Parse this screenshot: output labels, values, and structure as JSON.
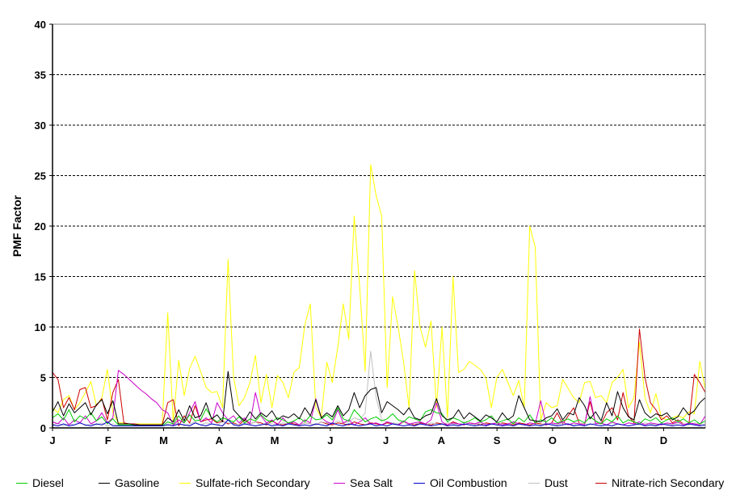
{
  "chart_data": {
    "type": "line",
    "xlabel": "",
    "ylabel": "PMF Factor",
    "ylim": [
      0,
      40
    ],
    "yticks": [
      0,
      5,
      10,
      15,
      20,
      25,
      30,
      35,
      40
    ],
    "month_labels": [
      "J",
      "F",
      "M",
      "A",
      "M",
      "J",
      "J",
      "A",
      "S",
      "O",
      "N",
      "D"
    ],
    "grid": "horizontal dashed",
    "legend_position": "bottom",
    "x_unit": "sample index (time order, Jan-Dec)",
    "x": [
      0,
      1,
      2,
      3,
      4,
      5,
      6,
      7,
      8,
      9,
      10,
      11,
      12,
      13,
      14,
      15,
      16,
      17,
      18,
      19,
      20,
      21,
      22,
      23,
      24,
      25,
      26,
      27,
      28,
      29,
      30,
      31,
      32,
      33,
      34,
      35,
      36,
      37,
      38,
      39,
      40,
      41,
      42,
      43,
      44,
      45,
      46,
      47,
      48,
      49,
      50,
      51,
      52,
      53,
      54,
      55,
      56,
      57,
      58,
      59,
      60,
      61,
      62,
      63,
      64,
      65,
      66,
      67,
      68,
      69,
      70,
      71,
      72,
      73,
      74,
      75,
      76,
      77,
      78,
      79,
      80,
      81,
      82,
      83,
      84,
      85,
      86,
      87,
      88,
      89,
      90,
      91,
      92,
      93,
      94,
      95,
      96,
      97,
      98,
      99,
      100,
      101,
      102,
      103,
      104,
      105,
      106,
      107,
      108,
      109,
      110,
      111,
      112,
      113,
      114,
      115,
      116,
      117,
      118,
      119
    ],
    "series": [
      {
        "name": "Diesel",
        "color": "#00cc00",
        "values": [
          1.0,
          1.4,
          0.8,
          1.8,
          0.6,
          1.2,
          0.9,
          1.5,
          0.7,
          1.1,
          0.4,
          0.9,
          0.3,
          0.3,
          0.3,
          0.3,
          0.2,
          0.2,
          0.2,
          0.2,
          0.2,
          0.6,
          0.4,
          1.2,
          0.5,
          1.3,
          0.7,
          0.8,
          1.9,
          1.0,
          0.6,
          1.0,
          0.8,
          0.6,
          1.1,
          0.5,
          0.9,
          0.7,
          1.3,
          0.8,
          0.6,
          1.0,
          0.8,
          0.5,
          0.7,
          1.0,
          0.6,
          1.2,
          0.8,
          0.9,
          1.3,
          0.8,
          2.0,
          0.9,
          0.7,
          1.8,
          1.2,
          0.6,
          0.9,
          1.1,
          0.7,
          0.9,
          1.4,
          0.8,
          0.6,
          1.1,
          0.9,
          0.7,
          1.6,
          1.8,
          1.5,
          1.4,
          0.6,
          1.0,
          0.8,
          0.5,
          0.7,
          1.0,
          0.6,
          0.8,
          1.2,
          0.5,
          0.7,
          0.9,
          0.4,
          1.0,
          0.6,
          1.3,
          0.5,
          0.8,
          0.6,
          1.0,
          0.5,
          0.7,
          0.9,
          0.6,
          0.8,
          0.5,
          1.1,
          0.7,
          0.4,
          0.9,
          0.6,
          1.2,
          0.5,
          0.8,
          0.6,
          0.4,
          0.9,
          0.7,
          1.0,
          0.5,
          0.8,
          1.0,
          0.6,
          0.9,
          0.5,
          0.8,
          0.4,
          0.7
        ]
      },
      {
        "name": "Gasoline",
        "color": "#000000",
        "values": [
          1.6,
          2.6,
          1.2,
          2.4,
          1.5,
          2.0,
          2.5,
          1.3,
          2.3,
          2.8,
          1.4,
          2.7,
          0.4,
          0.4,
          0.4,
          0.3,
          0.3,
          0.3,
          0.3,
          0.3,
          0.3,
          1.0,
          0.6,
          1.8,
          0.7,
          2.2,
          1.0,
          1.2,
          2.5,
          0.9,
          1.3,
          0.6,
          5.6,
          1.8,
          1.2,
          0.7,
          1.6,
          0.9,
          1.5,
          1.1,
          1.7,
          0.8,
          1.2,
          1.0,
          1.4,
          0.9,
          2.0,
          1.2,
          2.8,
          1.0,
          1.5,
          1.1,
          2.2,
          1.2,
          1.8,
          3.5,
          2.0,
          3.2,
          3.8,
          4.0,
          1.5,
          2.6,
          2.2,
          1.8,
          1.3,
          2.0,
          1.0,
          0.8,
          1.2,
          1.4,
          2.9,
          1.2,
          0.8,
          1.0,
          1.8,
          0.9,
          1.5,
          1.1,
          0.7,
          1.3,
          1.0,
          0.6,
          1.5,
          0.8,
          1.2,
          3.2,
          2.0,
          0.8,
          0.7,
          0.6,
          1.0,
          1.2,
          1.9,
          0.8,
          1.5,
          1.3,
          3.0,
          2.2,
          0.9,
          1.6,
          0.7,
          2.5,
          1.2,
          3.6,
          2.0,
          1.1,
          0.8,
          2.8,
          1.5,
          1.0,
          1.4,
          1.2,
          1.5,
          0.8,
          1.1,
          2.0,
          1.3,
          1.7,
          2.5,
          3.0
        ]
      },
      {
        "name": "Sulfate-rich Secondary",
        "color": "#ffff00",
        "values": [
          2.0,
          1.5,
          2.8,
          3.2,
          1.8,
          2.5,
          3.5,
          4.6,
          2.2,
          3.0,
          5.8,
          1.5,
          0.5,
          0.5,
          0.4,
          0.4,
          0.4,
          0.4,
          0.4,
          0.4,
          0.4,
          11.4,
          0.6,
          6.7,
          3.2,
          5.9,
          7.1,
          5.6,
          4.0,
          3.5,
          3.6,
          2.0,
          16.7,
          5.0,
          2.2,
          3.0,
          4.5,
          7.2,
          2.5,
          5.3,
          2.0,
          5.2,
          4.5,
          3.0,
          5.5,
          6.0,
          10.2,
          12.3,
          2.0,
          1.0,
          6.5,
          4.5,
          8.0,
          12.3,
          8.8,
          21.0,
          14.0,
          5.6,
          26.1,
          23.0,
          21.0,
          4.0,
          13.0,
          10.0,
          6.5,
          2.0,
          15.6,
          10.0,
          8.0,
          10.6,
          2.0,
          10.0,
          1.0,
          15.0,
          5.5,
          5.8,
          6.6,
          6.2,
          5.8,
          5.0,
          2.0,
          5.0,
          5.8,
          4.5,
          3.2,
          4.7,
          2.0,
          20.0,
          17.9,
          0.8,
          2.5,
          2.0,
          2.2,
          4.8,
          3.9,
          3.0,
          2.5,
          4.5,
          4.6,
          3.0,
          3.2,
          2.5,
          4.5,
          5.0,
          5.8,
          2.0,
          3.0,
          8.5,
          3.0,
          1.5,
          3.4,
          1.0,
          0.8,
          1.0,
          1.2,
          1.0,
          1.6,
          1.4,
          6.6,
          3.8
        ]
      },
      {
        "name": "Sea Salt",
        "color": "#cc00cc",
        "values": [
          0.6,
          0.4,
          1.0,
          0.3,
          0.8,
          0.5,
          1.2,
          0.4,
          0.7,
          1.5,
          0.5,
          1.0,
          5.7,
          5.3,
          4.8,
          4.3,
          3.8,
          3.4,
          2.9,
          2.5,
          1.8,
          1.5,
          0.3,
          0.8,
          0.5,
          1.5,
          2.6,
          0.6,
          1.0,
          0.5,
          2.5,
          1.5,
          0.8,
          1.2,
          0.5,
          1.0,
          0.4,
          3.5,
          1.2,
          0.5,
          0.8,
          0.3,
          1.0,
          0.4,
          0.6,
          0.3,
          0.8,
          0.5,
          2.9,
          1.0,
          0.6,
          0.4,
          1.8,
          0.5,
          0.8,
          0.3,
          0.6,
          1.0,
          0.4,
          0.5,
          0.3,
          0.6,
          0.4,
          0.3,
          0.7,
          0.4,
          0.5,
          0.6,
          0.4,
          0.8,
          2.5,
          0.6,
          0.3,
          0.5,
          0.4,
          0.3,
          0.5,
          0.4,
          0.6,
          0.3,
          0.4,
          0.5,
          0.3,
          0.4,
          0.6,
          0.4,
          0.3,
          0.5,
          0.4,
          2.7,
          0.3,
          0.5,
          0.4,
          0.6,
          0.3,
          0.5,
          0.4,
          0.3,
          3.1,
          0.4,
          0.5,
          0.3,
          0.6,
          0.4,
          0.3,
          0.5,
          0.4,
          0.6,
          0.3,
          0.5,
          0.4,
          0.3,
          0.5,
          0.4,
          0.6,
          0.3,
          0.5,
          0.4,
          0.3,
          1.2
        ]
      },
      {
        "name": "Oil Combustion",
        "color": "#0000cc",
        "values": [
          0.3,
          0.2,
          0.4,
          0.2,
          0.3,
          0.5,
          0.3,
          0.2,
          0.4,
          0.3,
          0.6,
          0.2,
          0.2,
          0.2,
          0.2,
          0.2,
          0.2,
          0.2,
          0.2,
          0.2,
          0.2,
          0.3,
          0.2,
          0.4,
          0.3,
          0.2,
          0.5,
          0.3,
          0.2,
          0.4,
          0.3,
          0.2,
          0.8,
          0.3,
          0.2,
          0.4,
          0.3,
          0.2,
          0.3,
          0.4,
          0.2,
          0.3,
          0.2,
          0.4,
          0.3,
          0.2,
          0.3,
          0.2,
          0.4,
          0.3,
          0.2,
          0.5,
          0.3,
          0.2,
          0.4,
          0.3,
          0.2,
          0.3,
          0.4,
          0.2,
          0.3,
          0.2,
          0.4,
          0.3,
          0.2,
          0.3,
          0.2,
          0.4,
          0.3,
          0.2,
          0.3,
          0.4,
          0.2,
          0.3,
          0.2,
          0.4,
          0.3,
          0.2,
          0.3,
          0.2,
          0.4,
          0.3,
          0.2,
          0.3,
          0.2,
          0.4,
          0.3,
          0.2,
          0.3,
          0.2,
          0.4,
          0.3,
          0.2,
          0.3,
          0.4,
          0.2,
          0.3,
          0.2,
          0.4,
          0.3,
          0.2,
          0.3,
          0.2,
          0.4,
          0.3,
          0.2,
          0.3,
          0.4,
          0.2,
          0.3,
          0.2,
          0.4,
          0.3,
          0.2,
          0.3,
          0.2,
          0.4,
          0.3,
          0.2,
          0.3
        ]
      },
      {
        "name": "Dust",
        "color": "#c0c0c0",
        "values": [
          0.3,
          0.5,
          0.2,
          0.4,
          0.3,
          0.6,
          0.2,
          0.4,
          0.3,
          0.5,
          0.2,
          0.4,
          0.2,
          0.2,
          0.2,
          0.2,
          0.2,
          0.2,
          0.2,
          0.2,
          0.2,
          0.4,
          0.3,
          0.5,
          0.2,
          0.4,
          0.6,
          0.3,
          0.5,
          0.4,
          0.3,
          0.6,
          0.5,
          0.4,
          0.3,
          0.5,
          0.4,
          0.6,
          0.3,
          0.5,
          0.4,
          0.3,
          0.5,
          0.4,
          0.6,
          0.3,
          0.5,
          0.4,
          0.3,
          0.6,
          0.5,
          0.4,
          0.7,
          0.5,
          0.6,
          1.0,
          0.8,
          1.5,
          7.6,
          3.0,
          0.8,
          0.6,
          0.5,
          0.4,
          0.6,
          0.3,
          0.5,
          0.4,
          0.3,
          0.5,
          0.4,
          0.3,
          0.5,
          0.4,
          0.3,
          0.6,
          0.4,
          0.3,
          0.5,
          0.4,
          0.3,
          0.5,
          0.4,
          0.3,
          0.5,
          0.4,
          0.3,
          0.5,
          0.4,
          0.3,
          0.5,
          0.4,
          0.3,
          0.5,
          0.4,
          0.3,
          0.5,
          0.4,
          0.3,
          0.5,
          0.4,
          0.3,
          0.5,
          0.4,
          0.3,
          0.5,
          0.4,
          0.3,
          0.5,
          0.4,
          0.3,
          0.5,
          0.4,
          0.3,
          0.5,
          0.4,
          0.3,
          0.5,
          0.4,
          0.3
        ]
      },
      {
        "name": "Nitrate-rich Secondary",
        "color": "#cc0000",
        "values": [
          5.5,
          4.8,
          2.0,
          3.0,
          1.8,
          3.8,
          4.0,
          2.0,
          2.2,
          2.9,
          0.8,
          3.5,
          4.8,
          0.5,
          0.4,
          0.4,
          0.3,
          0.3,
          0.3,
          0.3,
          0.3,
          2.5,
          2.8,
          0.2,
          1.2,
          0.5,
          2.2,
          0.6,
          0.8,
          0.9,
          0.5,
          0.7,
          0.4,
          0.5,
          0.3,
          0.8,
          0.4,
          0.6,
          0.5,
          0.3,
          0.7,
          0.4,
          0.3,
          0.5,
          0.4,
          0.3,
          0.5,
          0.4,
          0.3,
          0.6,
          0.4,
          0.3,
          0.5,
          0.4,
          0.3,
          0.6,
          0.4,
          0.3,
          0.5,
          0.4,
          0.3,
          0.5,
          0.4,
          0.3,
          0.6,
          0.4,
          0.3,
          0.5,
          0.4,
          0.3,
          0.5,
          0.4,
          0.3,
          0.6,
          0.4,
          0.3,
          0.5,
          0.4,
          0.3,
          0.5,
          0.4,
          0.3,
          0.5,
          0.4,
          0.3,
          0.5,
          0.4,
          0.3,
          0.5,
          0.4,
          0.3,
          0.5,
          1.5,
          0.4,
          1.2,
          2.0,
          0.5,
          0.4,
          2.6,
          0.5,
          0.4,
          1.5,
          2.0,
          0.8,
          3.5,
          1.2,
          0.5,
          9.8,
          5.0,
          2.5,
          1.8,
          0.8,
          1.2,
          0.5,
          0.8,
          0.4,
          0.3,
          5.3,
          4.5,
          3.5
        ]
      }
    ]
  }
}
